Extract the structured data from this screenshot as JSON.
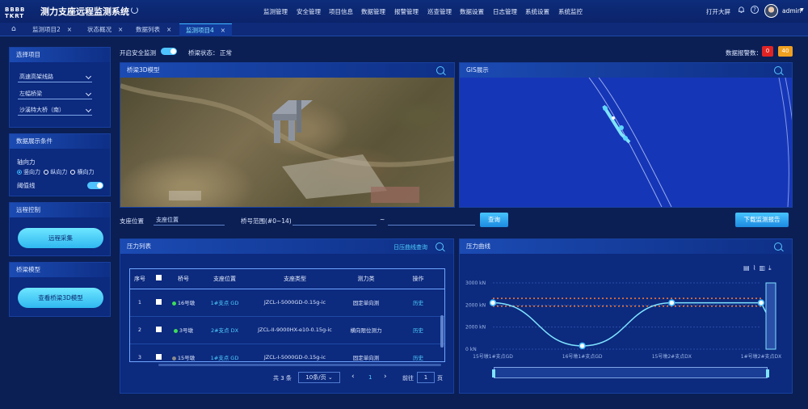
{
  "header": {
    "logo_text": "BBBB TKRT",
    "title": "测力支座远程监测系统",
    "nav": [
      "监测管理",
      "安全管理",
      "项目信息",
      "数据管理",
      "报警管理",
      "巡查管理",
      "数据设置",
      "日志管理",
      "系统设置",
      "系统监控"
    ],
    "screen_button": "打开大屏",
    "user_name": "admin"
  },
  "tabs": [
    {
      "label": "监测项目2",
      "active": false
    },
    {
      "label": "状态概况",
      "active": false
    },
    {
      "label": "数据列表",
      "active": false
    },
    {
      "label": "监测项目4",
      "active": true
    }
  ],
  "left": {
    "project": {
      "title": "选择项目",
      "selects": [
        "高速高架线路",
        "左幅桥梁",
        "沙溪特大桥（南）"
      ]
    },
    "display": {
      "title": "数据展示条件",
      "force_label": "轴向力",
      "radios": [
        {
          "label": "竖向力",
          "on": true
        },
        {
          "label": "纵向力",
          "on": false
        },
        {
          "label": "横向力",
          "on": false
        }
      ],
      "threshold_label": "阈值线"
    },
    "remote": {
      "title": "远程控制",
      "button": "远程采集"
    },
    "model": {
      "title": "桥梁模型",
      "button": "查看桥梁3D模型"
    }
  },
  "status_bar": {
    "safety_label": "开启安全监测",
    "state_label": "桥梁状态：",
    "state_value": "正常",
    "alarm_label": "数据报警数：",
    "alarm_red": "0",
    "alarm_orange": "40"
  },
  "model_panel": {
    "title": "桥梁3D模型"
  },
  "map_panel": {
    "title": "GIS展示"
  },
  "query": {
    "position_label": "支座位置",
    "position_placeholder": "支座位置",
    "range_label": "桥号范围(#0~14)",
    "range_sep": "~",
    "query_button": "查询",
    "report_button": "下载监测报告"
  },
  "pressure_list": {
    "title": "压力列表",
    "history_link": "日压曲线查询",
    "columns": [
      "序号",
      "",
      "桥号",
      "支座位置",
      "支座类型",
      "测力类",
      "操作"
    ],
    "rows": [
      {
        "no": "1",
        "pier": "16号墩",
        "dot": "#3ddc5a",
        "position": "1#支点 GD",
        "type": "JZCL-I-5000GD-0.15g-ic",
        "kind": "固定单向测",
        "op": "历史"
      },
      {
        "no": "2",
        "pier": "3号墩",
        "dot": "#3ddc5a",
        "position": "2#支点 DX",
        "type": "JZCL-II-9000HX-e10-0.15g-ic",
        "kind": "横向限位测力",
        "op": "历史"
      },
      {
        "no": "3",
        "pier": "15号墩",
        "dot": "#8a8a8a",
        "position": "1#支点 GD",
        "type": "JZCL-I-5000GD-0.15g-ic",
        "kind": "固定单向测",
        "op": "历史"
      }
    ],
    "pager": {
      "total": "共 3 条",
      "per_page": "10条/页",
      "prev": "‹",
      "page": "1",
      "next": "›",
      "goto_label": "前往",
      "goto_value": "1",
      "page_unit": "页"
    }
  },
  "curve_panel": {
    "title": "压力曲线"
  },
  "chart_data": {
    "type": "line",
    "categories": [
      "15号墩1#支点GD",
      "16号墩1#支点GD",
      "15号墩2#支点DX",
      "1#号墩2#支点DX"
    ],
    "y_tick_labels": [
      "3000 kN",
      "2000 kN",
      "2000 kN",
      "0 kN"
    ],
    "series": [
      {
        "values": [
          2100,
          150,
          2100,
          2100
        ]
      }
    ],
    "threshold_upper": 2300,
    "threshold_lower": 1950,
    "ylim": [
      0,
      3000
    ],
    "toolbar_icons": [
      "data-view-icon",
      "line-icon",
      "bar-icon",
      "download-icon"
    ]
  }
}
